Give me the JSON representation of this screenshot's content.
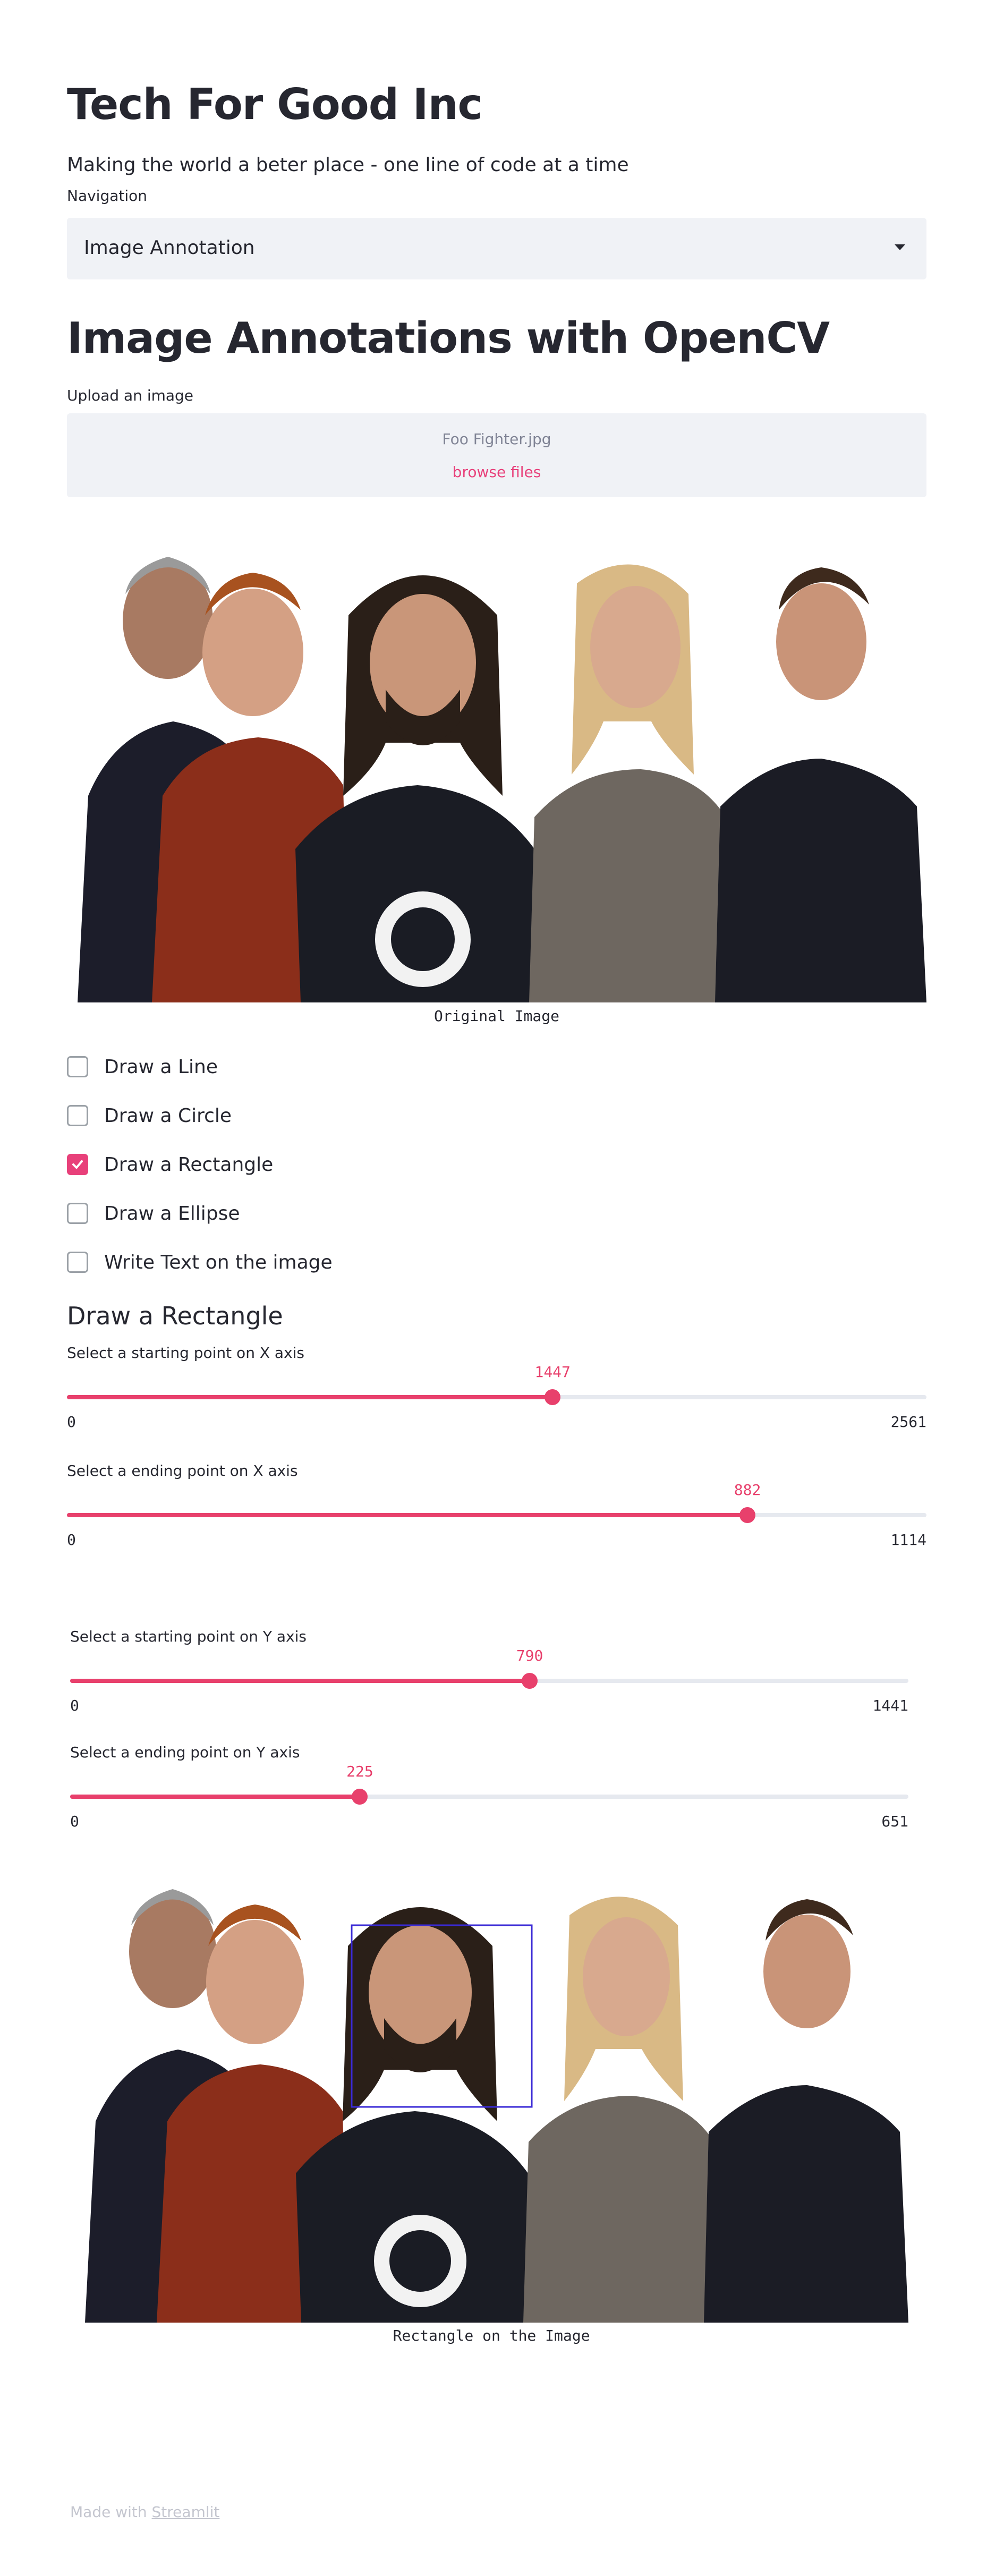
{
  "header": {
    "title": "Tech For Good Inc",
    "subtitle": "Making the world a beter place - one line of code at a time"
  },
  "navigation": {
    "label": "Navigation",
    "selected": "Image Annotation"
  },
  "main": {
    "title": "Image Annotations with OpenCV",
    "upload": {
      "label": "Upload an image",
      "file_name": "Foo Fighter.jpg",
      "browse_label": "browse files"
    },
    "original_caption": "Original Image",
    "options": [
      {
        "label": "Draw a Line",
        "checked": false
      },
      {
        "label": "Draw a Circle",
        "checked": false
      },
      {
        "label": "Draw a Rectangle",
        "checked": true
      },
      {
        "label": "Draw a Ellipse",
        "checked": false
      },
      {
        "label": "Write Text on the image",
        "checked": false
      }
    ],
    "section_title": "Draw a Rectangle",
    "sliders": [
      {
        "label": "Select a starting point on X axis",
        "value": 1447,
        "min": 0,
        "max": 2561
      },
      {
        "label": "Select a ending point on X axis",
        "value": 882,
        "min": 0,
        "max": 1114
      },
      {
        "label": "Select a starting point on Y axis",
        "value": 790,
        "min": 0,
        "max": 1441
      },
      {
        "label": "Select a ending point on Y axis",
        "value": 225,
        "min": 0,
        "max": 651
      }
    ],
    "result_caption": "Rectangle on the Image",
    "rectangle_color": "#3a2ad6"
  },
  "footer": {
    "prefix": "Made with ",
    "link": "Streamlit"
  },
  "colors": {
    "accent": "#e8406c",
    "input_bg": "#f0f2f6",
    "text": "#262730"
  }
}
